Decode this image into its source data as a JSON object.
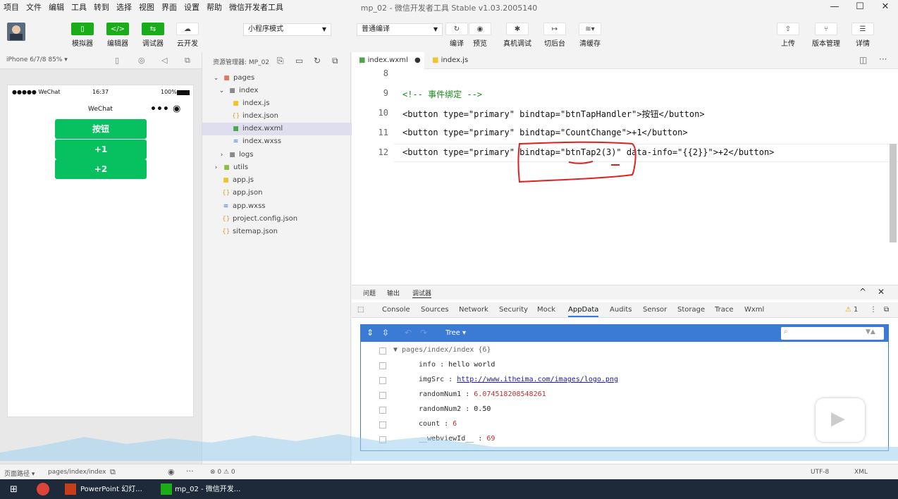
{
  "menubar": {
    "items": [
      "项目",
      "文件",
      "编辑",
      "工具",
      "转到",
      "选择",
      "视图",
      "界面",
      "设置",
      "帮助",
      "微信开发者工具"
    ],
    "title": "mp_02 - 微信开发者工具 Stable v1.03.2005140"
  },
  "toolbar": {
    "simulator": "模拟器",
    "editor": "编辑器",
    "debugger": "调试器",
    "cloud": "云开发",
    "mode_select": "小程序模式",
    "compile_select": "普通编译",
    "compile": "编译",
    "preview": "预览",
    "real_debug": "真机调试",
    "background": "切后台",
    "clear_cache": "清缓存",
    "upload": "上传",
    "version": "版本管理",
    "details": "详情"
  },
  "simulator": {
    "device": "iPhone 6/7/8 85% ▾",
    "carrier": "●●●●● WeChat",
    "time": "16:37",
    "battery": "100%",
    "nav_title": "WeChat",
    "buttons": [
      "按钮",
      "+1",
      "+2"
    ]
  },
  "explorer": {
    "header": "资源管理器: MP_02",
    "tree": [
      {
        "name": "pages",
        "icon": "folder-icon"
      },
      {
        "name": "index",
        "icon": "folder-icon"
      },
      {
        "name": "index.js",
        "icon": "js-file-icon"
      },
      {
        "name": "index.json",
        "icon": "json-file-icon"
      },
      {
        "name": "index.wxml",
        "icon": "wxml-file-icon"
      },
      {
        "name": "index.wxss",
        "icon": "wxss-file-icon"
      },
      {
        "name": "logs",
        "icon": "folder-icon"
      },
      {
        "name": "utils",
        "icon": "folder-icon"
      },
      {
        "name": "app.js",
        "icon": "js-file-icon"
      },
      {
        "name": "app.json",
        "icon": "json-file-icon"
      },
      {
        "name": "app.wxss",
        "icon": "wxss-file-icon"
      },
      {
        "name": "project.config.json",
        "icon": "json-file-icon"
      },
      {
        "name": "sitemap.json",
        "icon": "json-file-icon"
      }
    ]
  },
  "editor": {
    "tabs": [
      "index.wxml",
      "index.js"
    ],
    "lines": [
      {
        "num": "8",
        "code": ""
      },
      {
        "num": "9",
        "code": "<!-- 事件绑定 -->"
      },
      {
        "num": "10",
        "code": "<button type=\"primary\" bindtap=\"btnTapHandler\">按钮</button>"
      },
      {
        "num": "11",
        "code": "<button type=\"primary\" bindtap=\"CountChange\">+1</button>"
      },
      {
        "num": "12",
        "code": "<button type=\"primary\" bindtap=\"btnTap2(3)\" data-info=\"{{2}}\">+2</button>"
      }
    ]
  },
  "debugger": {
    "top_tabs": [
      "问题",
      "输出",
      "调试器"
    ],
    "tabs": [
      "Console",
      "Sources",
      "Network",
      "Security",
      "Mock",
      "AppData",
      "Audits",
      "Sensor",
      "Storage",
      "Trace",
      "Wxml"
    ],
    "warn_count": "1",
    "tree_label": "Tree ▾",
    "root": "▼  pages/index/index {6}",
    "entries": [
      {
        "key": "info",
        "value": "hello world"
      },
      {
        "key": "imgSrc",
        "value": "http://www.itheima.com/images/logo.png"
      },
      {
        "key": "randomNum1",
        "value": "6.074518208548261"
      },
      {
        "key": "randomNum2",
        "value": "0.50"
      },
      {
        "key": "count",
        "value": "6"
      },
      {
        "key": "__webviewId__",
        "value": "69"
      }
    ]
  },
  "statusbar": {
    "path_label": "页面路径 ▾",
    "path": "pages/index/index",
    "errors": "⊗ 0 ⚠ 0",
    "encoding": "UTF-8",
    "lang": "XML"
  },
  "taskbar": {
    "items": [
      "PowerPoint 幻灯...",
      "mp_02 - 微信开发..."
    ]
  }
}
